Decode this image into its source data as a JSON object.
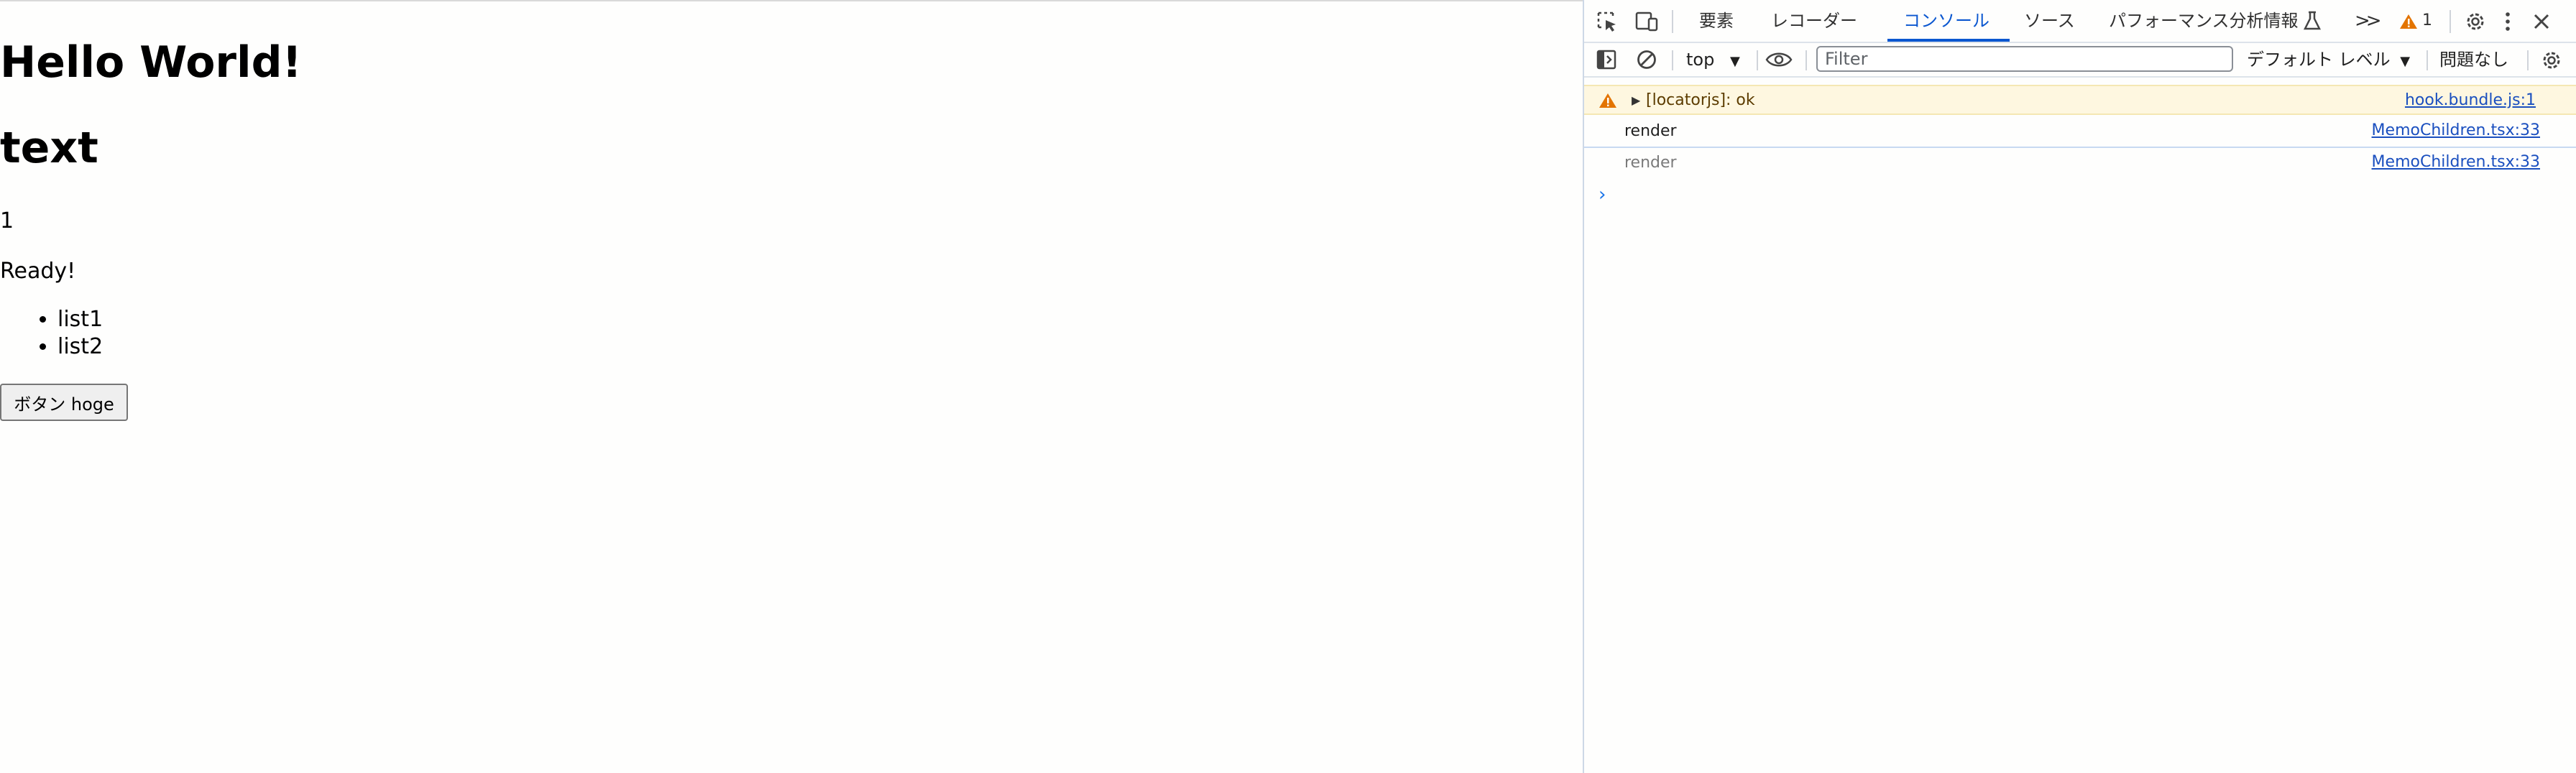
{
  "page": {
    "heading1": "Hello World!",
    "heading2": "text",
    "counter": "1",
    "status": "Ready!",
    "list": [
      "list1",
      "list2"
    ],
    "button_label": "ボタン hoge"
  },
  "devtools": {
    "tabs": [
      {
        "label": "要素",
        "active": false
      },
      {
        "label": "レコーダー",
        "active": false
      },
      {
        "label": "コンソール",
        "active": true
      },
      {
        "label": "ソース",
        "active": false
      },
      {
        "label": "パフォーマンス分析情報",
        "active": false
      }
    ],
    "more_tabs_icon": ">>",
    "warning_count": "1",
    "context_select": "top",
    "filter_placeholder": "Filter",
    "level_select": "デフォルト レベル",
    "issues_label": "問題なし",
    "messages": [
      {
        "type": "warning",
        "text": "[locatorjs]: ok",
        "source": "hook.bundle.js:1"
      },
      {
        "type": "log",
        "text": "render",
        "source": "MemoChildren.tsx:33"
      },
      {
        "type": "log-faded",
        "text": "render",
        "source": "MemoChildren.tsx:33"
      }
    ],
    "colors": {
      "accent": "#0b57d0",
      "warning_bg": "#fef7e0",
      "warning_icon": "#e37400",
      "link": "#1a4fbf"
    }
  }
}
